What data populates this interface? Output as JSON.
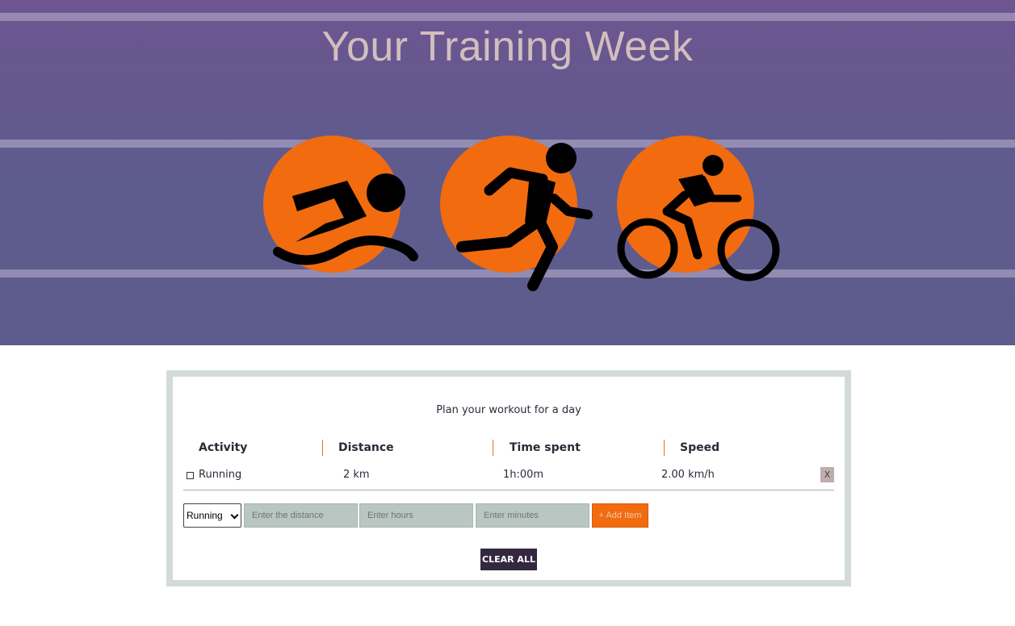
{
  "hero": {
    "title": "Your Training Week",
    "icons": [
      "swimming-icon",
      "running-icon",
      "cycling-icon"
    ],
    "accent_color": "#f26b0f",
    "background_color": "#6d5590"
  },
  "planner": {
    "subtitle": "Plan your workout for a day",
    "columns": [
      "Activity",
      "Distance",
      "Time spent",
      "Speed"
    ],
    "rows": [
      {
        "activity": "Running",
        "distance": "2 km",
        "time": "1h:00m",
        "speed": "2.00 km/h",
        "delete_label": "X"
      }
    ],
    "form": {
      "activity_selected": "Running",
      "distance_placeholder": "Enter the distance",
      "hours_placeholder": "Enter hours",
      "minutes_placeholder": "Enter minutes",
      "add_label": "+ Add Item"
    },
    "clear_label": "CLEAR ALL"
  }
}
